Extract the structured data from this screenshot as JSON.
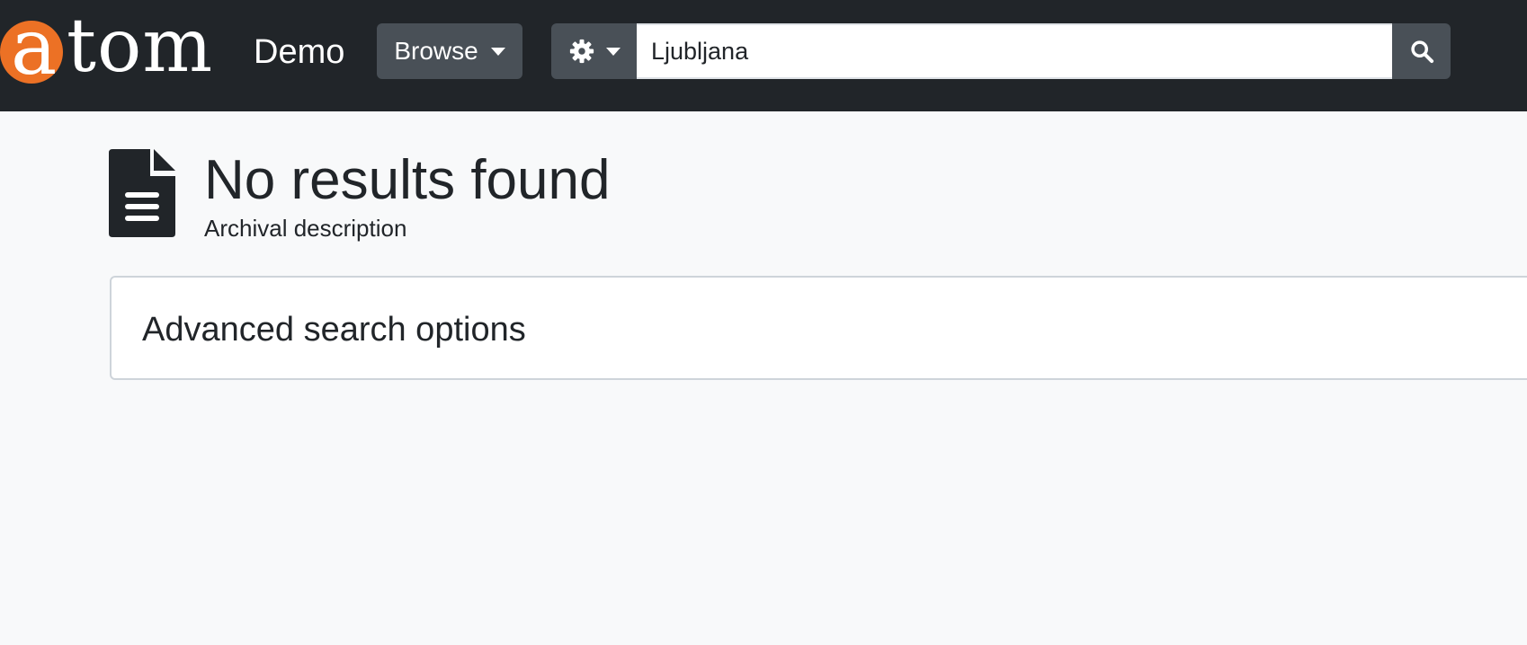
{
  "header": {
    "logo_prefix": "a",
    "logo_suffix": "tom",
    "site_name": "Demo",
    "browse_label": "Browse",
    "search": {
      "value": "Ljubljana",
      "options_icon": "gear-icon",
      "submit_icon": "search-icon"
    }
  },
  "main": {
    "title": "No results found",
    "subtitle": "Archival description",
    "title_icon": "file-icon",
    "advanced_search_label": "Advanced search options"
  },
  "colors": {
    "navbar": "#212529",
    "brand_orange": "#ec7125",
    "button_gray": "#495057",
    "page_background": "#f8f9fa"
  }
}
